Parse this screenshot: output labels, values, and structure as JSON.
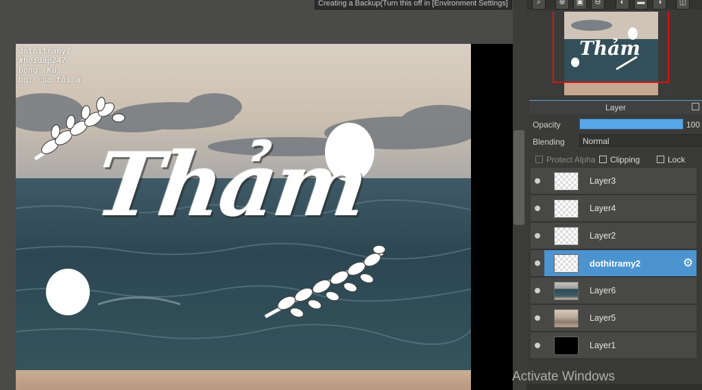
{
  "canvas": {
    "backup_tip": "Creating a Backup(Turn this off in [Environment Settings]",
    "watermark_lines": [
      "dothitramy2",
      "#hoidap247",
      "bóng: Ku",
      "bg: của tôi á"
    ],
    "artwork_title": "Thảm"
  },
  "system": {
    "activate_windows": "Activate Windows"
  },
  "navigator": {
    "toolbar_icons": [
      "zoom-fit-icon",
      "zoom-in-icon",
      "actual-size-icon",
      "zoom-out-icon",
      "rotate-left-icon",
      "flip-icon",
      "rotate-right-icon",
      "split-view-icon"
    ]
  },
  "layer_panel": {
    "title": "Layer",
    "opacity_label": "Opacity",
    "opacity_value": "100",
    "opacity_percent": 100,
    "blending_label": "Blending",
    "blending_value": "Normal",
    "protect_alpha_label": "Protect Alpha",
    "clipping_label": "Clipping",
    "lock_label": "Lock",
    "layers": [
      {
        "name": "Layer3",
        "thumb": "transparent",
        "selected": false
      },
      {
        "name": "Layer4",
        "thumb": "transparent",
        "selected": false
      },
      {
        "name": "Layer2",
        "thumb": "transparent",
        "selected": false
      },
      {
        "name": "dothitramy2",
        "thumb": "transparent",
        "selected": true
      },
      {
        "name": "Layer6",
        "thumb": "sea",
        "selected": false
      },
      {
        "name": "Layer5",
        "thumb": "beach",
        "selected": false
      },
      {
        "name": "Layer1",
        "thumb": "black",
        "selected": false
      }
    ]
  },
  "colors": {
    "selected_layer": "#4c94cf",
    "opacity_bar": "#57a6e6",
    "navigator_frame": "#dd1111"
  }
}
